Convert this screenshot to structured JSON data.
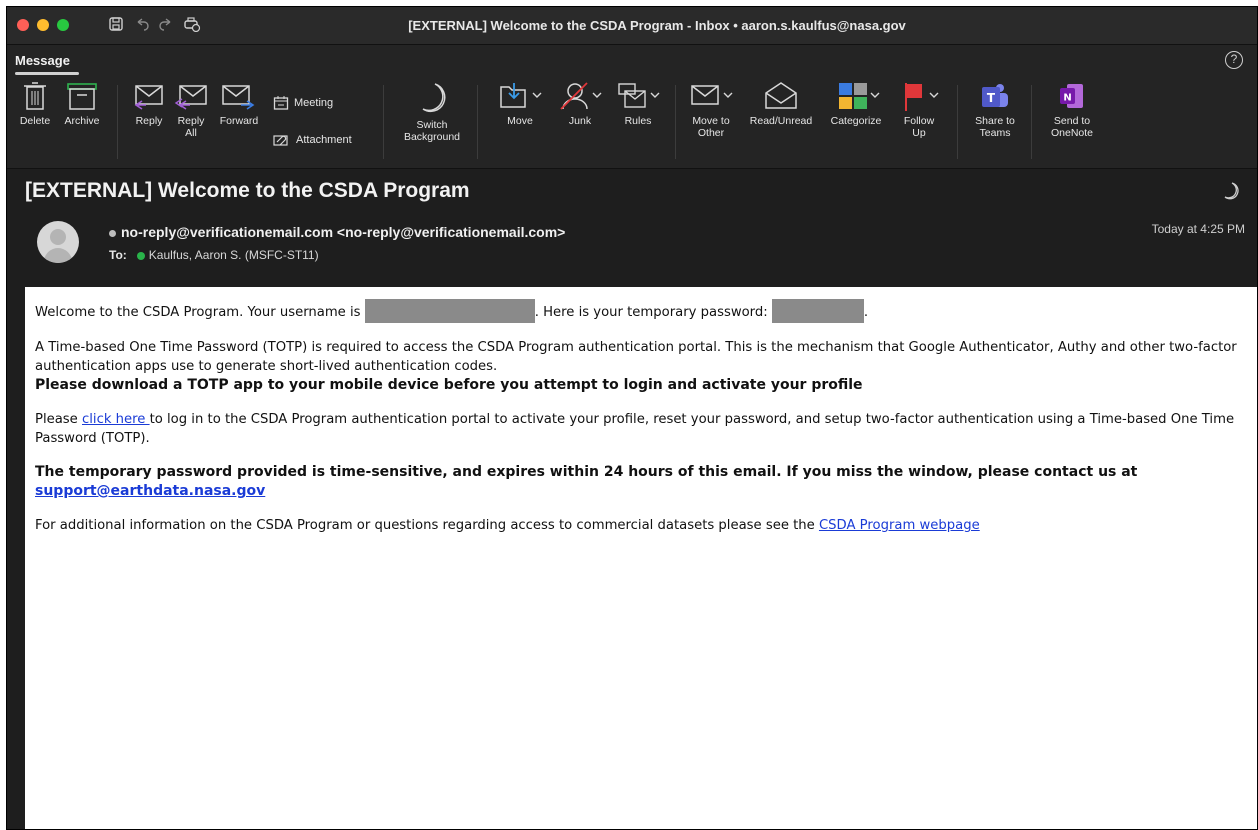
{
  "window": {
    "title": "[EXTERNAL] Welcome to the CSDA Program - Inbox • aaron.s.kaulfus@nasa.gov"
  },
  "titlebar_icons": [
    "save-icon",
    "undo-icon",
    "redo-icon",
    "print-icon"
  ],
  "ribbon": {
    "tab": "Message",
    "buttons": {
      "delete": "Delete",
      "archive": "Archive",
      "reply": "Reply",
      "reply_all_1": "Reply",
      "reply_all_2": "All",
      "forward": "Forward",
      "meeting": "Meeting",
      "attachment": "Attachment",
      "switch_bg_1": "Switch",
      "switch_bg_2": "Background",
      "move": "Move",
      "junk": "Junk",
      "rules": "Rules",
      "move_other_1": "Move to",
      "move_other_2": "Other",
      "read_unread": "Read/Unread",
      "categorize": "Categorize",
      "follow_up_1": "Follow",
      "follow_up_2": "Up",
      "share_teams_1": "Share to",
      "share_teams_2": "Teams",
      "onenote_1": "Send to",
      "onenote_2": "OneNote"
    }
  },
  "message": {
    "subject": "[EXTERNAL] Welcome to the CSDA Program",
    "sender": "no-reply@verificationemail.com <no-reply@verificationemail.com>",
    "to_label": "To:",
    "recipient": "Kaulfus, Aaron S. (MSFC-ST11)",
    "timestamp": "Today at 4:25 PM"
  },
  "body": {
    "p1_a": "Welcome to the CSDA Program. Your username is ",
    "p1_b": ". Here is your temporary password: ",
    "p1_c": ".",
    "p2": "A Time-based One Time Password (TOTP) is required to access the CSDA Program authentication portal. This is the mechanism that Google Authenticator, Authy and other two-factor authentication apps use to generate short-lived authentication codes.",
    "p2_bold": "Please download a TOTP app to your mobile device before you attempt to login and activate your profile",
    "p3_a": "Please ",
    "p3_link": "click here ",
    "p3_b": "to log in to the CSDA Program authentication portal to activate your profile, reset your password, and setup two-factor authentication using a Time-based One Time Password (TOTP).",
    "p4_bold": "The temporary password provided is time-sensitive, and expires within 24 hours of this email. If you miss the window, please contact us at ",
    "p4_link": "support@earthdata.nasa.gov",
    "p5_a": "For additional information on the CSDA Program or questions regarding access to commercial datasets please see the ",
    "p5_link": "CSDA Program webpage"
  }
}
